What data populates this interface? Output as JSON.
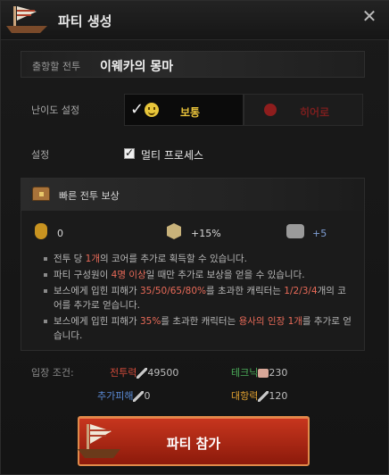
{
  "header": {
    "title": "파티 생성",
    "close_label": "✕"
  },
  "destination": {
    "label": "출항할 전투",
    "value": "이웨카의 몽마"
  },
  "difficulty": {
    "label": "난이도 설정",
    "normal": "보통",
    "hero": "히어로"
  },
  "settings": {
    "label": "설정",
    "multi_process": "멀티 프로세스",
    "multi_process_checked": true
  },
  "reward": {
    "title": "빠른 전투 보상",
    "core": "0",
    "exp": "+15%",
    "gear": "+5",
    "bullets": [
      {
        "pre": "전투 당 ",
        "em": "1개",
        "post": "의 코어를 추가로 획득할 수 있습니다."
      },
      {
        "pre": "파티 구성원이 ",
        "em": "4명 이상",
        "post": "일 때만 추가로 보상을 얻을 수 있습니다."
      },
      {
        "pre": "보스에게 입힌 피해가 ",
        "em": "35/50/65/80%",
        "mid": "를 초과한 캐릭터는 ",
        "em2": "1/2/3/4",
        "post": "개의 코어를 추가로 얻습니다."
      },
      {
        "pre": "보스에게 입힌 피해가 ",
        "em": "35%",
        "mid": "를 초과한 캐릭터는 ",
        "em2": "용사의 인장 1개",
        "post": "를 추가로 얻습니다."
      }
    ]
  },
  "entry": {
    "label": "입장 조건:",
    "combat_label": "전투력",
    "combat_value": "49500",
    "tech_label": "테크닉",
    "tech_value": "230",
    "extra_label": "추가피해",
    "extra_value": "0",
    "resist_label": "대항력",
    "resist_value": "120"
  },
  "join_button": {
    "label": "파티 참가"
  },
  "colors": {
    "red_accent": "#e86a58",
    "combat": "#d04a3a",
    "tech": "#4caf5a",
    "extra": "#5a8ad6",
    "resist": "#e0a030",
    "join_bg": "#b32a14",
    "normal": "#e8c23a",
    "hero": "#7a1e1e"
  },
  "icons": [
    "ship-icon",
    "close-icon",
    "check-icon",
    "smile-icon",
    "skull-icon",
    "checkbox-icon",
    "chest-icon",
    "bag-icon",
    "rank-icon",
    "gear-icon",
    "sword-icon",
    "tech-icon"
  ]
}
